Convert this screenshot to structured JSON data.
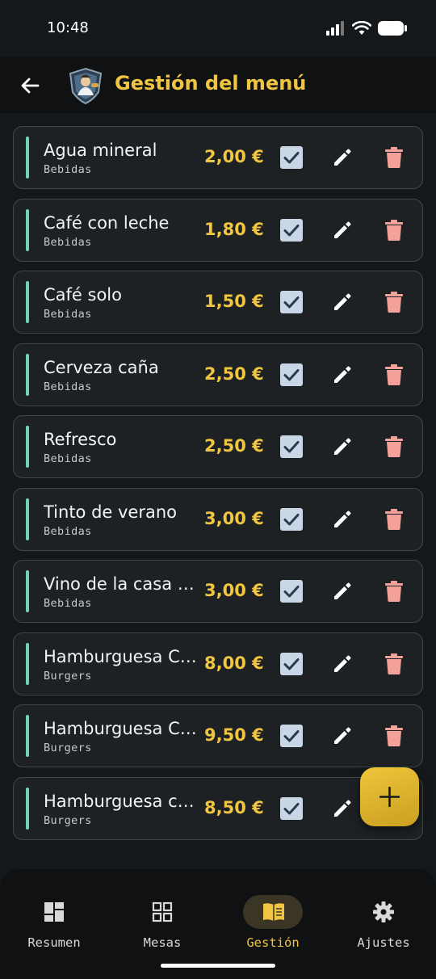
{
  "status_bar": {
    "time": "10:48"
  },
  "header": {
    "title": "Gestión del menú",
    "back_icon": "arrow-left-icon",
    "logo": "app-logo"
  },
  "items": [
    {
      "name": "Agua mineral",
      "category": "Bebidas",
      "price": "2,00 €",
      "available": true
    },
    {
      "name": "Café con leche",
      "category": "Bebidas",
      "price": "1,80 €",
      "available": true
    },
    {
      "name": "Café solo",
      "category": "Bebidas",
      "price": "1,50 €",
      "available": true
    },
    {
      "name": "Cerveza caña",
      "category": "Bebidas",
      "price": "2,50 €",
      "available": true
    },
    {
      "name": "Refresco",
      "category": "Bebidas",
      "price": "2,50 €",
      "available": true
    },
    {
      "name": "Tinto de verano",
      "category": "Bebidas",
      "price": "3,00 €",
      "available": true
    },
    {
      "name": "Vino de la casa (…",
      "category": "Bebidas",
      "price": "3,00 €",
      "available": true
    },
    {
      "name": "Hamburguesa C…",
      "category": "Burgers",
      "price": "8,00 €",
      "available": true
    },
    {
      "name": "Hamburguesa C…",
      "category": "Burgers",
      "price": "9,50 €",
      "available": true
    },
    {
      "name": "Hamburguesa c…",
      "category": "Burgers",
      "price": "8,50 €",
      "available": true
    }
  ],
  "fab": {
    "icon": "plus-icon"
  },
  "bottom_nav": [
    {
      "label": "Resumen",
      "icon": "dashboard-icon",
      "active": false
    },
    {
      "label": "Mesas",
      "icon": "grid-icon",
      "active": false
    },
    {
      "label": "Gestión",
      "icon": "menu-book-icon",
      "active": true
    },
    {
      "label": "Ajustes",
      "icon": "gear-icon",
      "active": false
    }
  ],
  "colors": {
    "accent": "#f0c541",
    "item_bar": "#6fd3b0",
    "delete": "#f4a19a",
    "checkbox": "#c8d6e5",
    "background": "#15181a"
  }
}
